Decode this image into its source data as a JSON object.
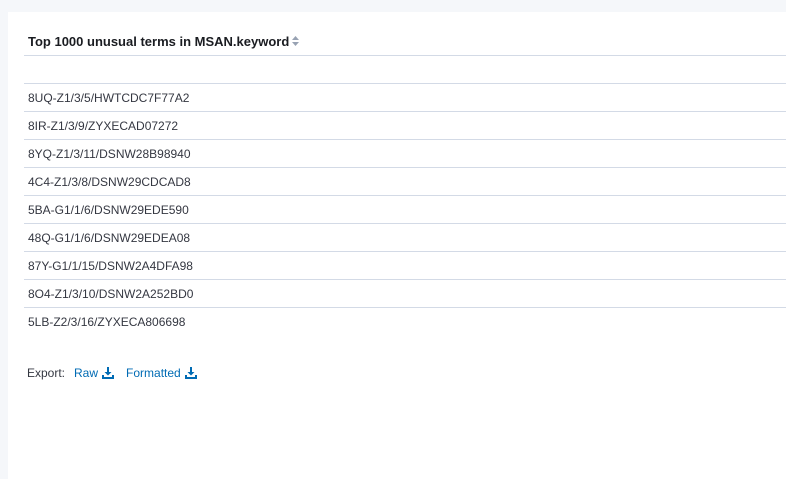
{
  "table": {
    "header": "Top 1000 unusual terms in MSAN.keyword",
    "rows": [
      "8UQ-Z1/3/5/HWTCDC7F77A2",
      "8IR-Z1/3/9/ZYXECAD07272",
      "8YQ-Z1/3/11/DSNW28B98940",
      "4C4-Z1/3/8/DSNW29CDCAD8",
      "5BA-G1/1/6/DSNW29EDE590",
      "48Q-G1/1/6/DSNW29EDEA08",
      "87Y-G1/1/15/DSNW2A4DFA98",
      "8O4-Z1/3/10/DSNW2A252BD0",
      "5LB-Z2/3/16/ZYXECA806698"
    ]
  },
  "export": {
    "label": "Export:",
    "raw": "Raw",
    "formatted": "Formatted"
  },
  "icons": {
    "sort": "sort-icon",
    "download": "download-icon"
  },
  "colors": {
    "link": "#006bb4",
    "border": "#d3dae6"
  }
}
